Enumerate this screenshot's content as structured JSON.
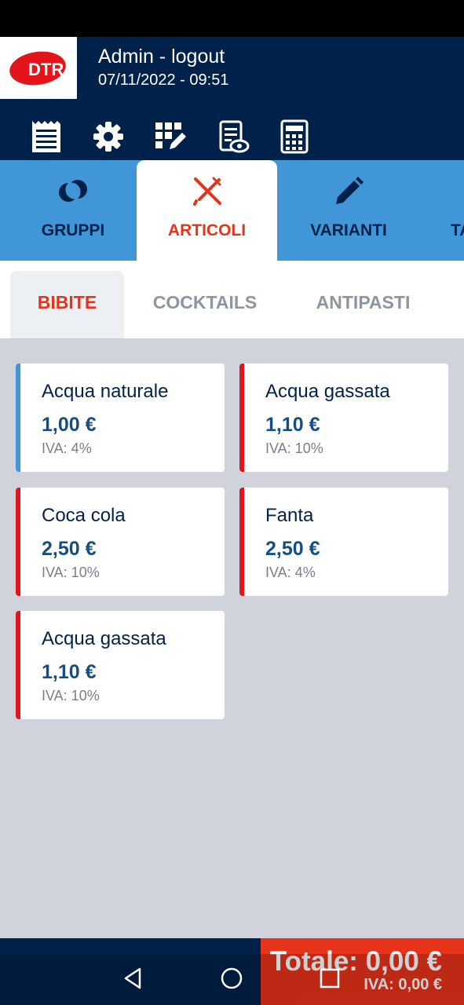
{
  "header": {
    "logo_text": "DTR",
    "user": "Admin - logout",
    "datetime": "07/11/2022 - 09:51"
  },
  "toolbar": [
    {
      "icon": "receipt-icon"
    },
    {
      "icon": "gear-icon"
    },
    {
      "icon": "grid-edit-icon"
    },
    {
      "icon": "document-view-icon"
    },
    {
      "icon": "calculator-icon"
    }
  ],
  "tabs": [
    {
      "label": "GRUPPI",
      "icon": "groups-icon"
    },
    {
      "label": "ARTICOLI",
      "icon": "fork-knife-icon",
      "active": true
    },
    {
      "label": "VARIANTI",
      "icon": "pencil-icon"
    },
    {
      "label": "TA"
    }
  ],
  "categories": [
    {
      "label": "BIBITE",
      "active": true
    },
    {
      "label": "COCKTAILS"
    },
    {
      "label": "ANTIPASTI"
    }
  ],
  "items": [
    {
      "name": "Acqua naturale",
      "price": "1,00 €",
      "vat": "IVA: 4%",
      "color": "#4196d8"
    },
    {
      "name": "Acqua gassata",
      "price": "1,10 €",
      "vat": "IVA: 10%",
      "color": "#e3141a"
    },
    {
      "name": "Coca cola",
      "price": "2,50 €",
      "vat": "IVA: 10%",
      "color": "#e3141a"
    },
    {
      "name": "Fanta",
      "price": "2,50 €",
      "vat": "IVA: 4%",
      "color": "#e3141a"
    },
    {
      "name": "Acqua gassata",
      "price": "1,10 €",
      "vat": "IVA: 10%",
      "color": "#e3141a"
    }
  ],
  "footer": {
    "total": "Totale: 0,00 €",
    "vat": "IVA: 0,00 €"
  },
  "colors": {
    "navy": "#00224a",
    "blue": "#4196d8",
    "accent": "#e7331a"
  }
}
